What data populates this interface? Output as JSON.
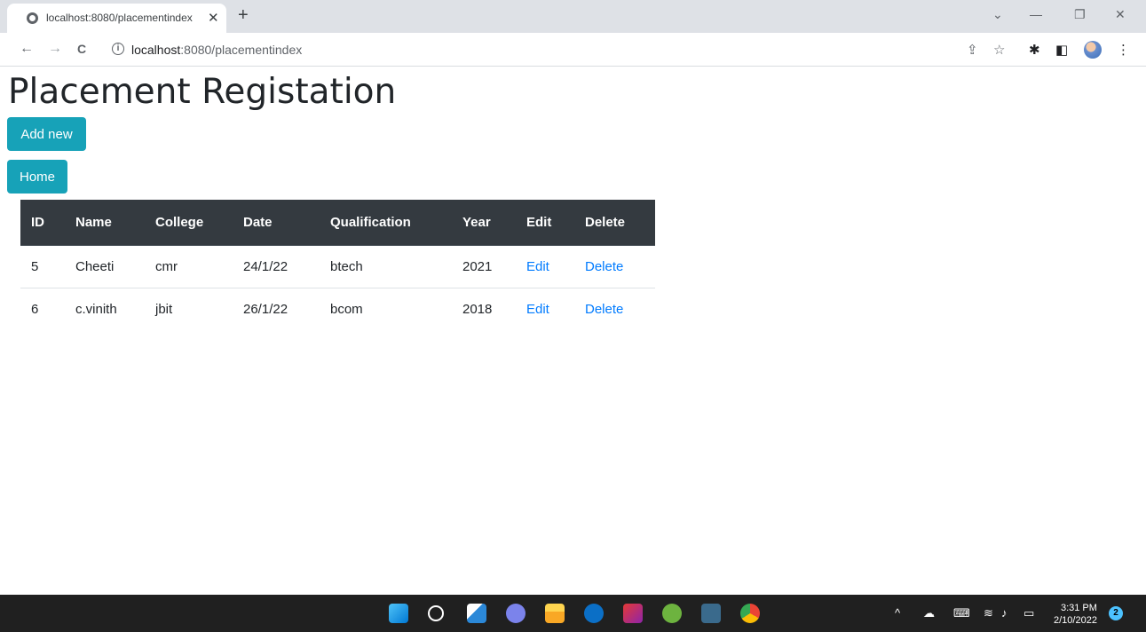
{
  "browser": {
    "tab_title": "localhost:8080/placementindex",
    "tab_close": "✕",
    "new_tab": "+",
    "url_host": "localhost",
    "url_rest": ":8080/placementindex",
    "window_controls": {
      "minimize": "—",
      "restore": "❐",
      "close": "✕",
      "tab_search": "⌄"
    },
    "toolbar_icons": {
      "back": "←",
      "forward": "→",
      "reload": "C",
      "info": "i",
      "share": "⇪",
      "bookmark": "☆",
      "extensions": "✱",
      "sidepanel": "◧",
      "menu": "⋮"
    }
  },
  "page": {
    "title": "Placement Registation",
    "add_new_label": "Add new",
    "home_label": "Home"
  },
  "table": {
    "headers": [
      "ID",
      "Name",
      "College",
      "Date",
      "Qualification",
      "Year",
      "Edit",
      "Delete"
    ],
    "rows": [
      {
        "id": "5",
        "name": "Cheeti",
        "college": "cmr",
        "date": "24/1/22",
        "qualification": "btech",
        "year": "2021",
        "edit": "Edit",
        "delete": "Delete"
      },
      {
        "id": "6",
        "name": "c.vinith",
        "college": "jbit",
        "date": "26/1/22",
        "qualification": "bcom",
        "year": "2018",
        "edit": "Edit",
        "delete": "Delete"
      }
    ]
  },
  "taskbar": {
    "time": "3:31 PM",
    "date": "2/10/2022",
    "notification_count": "2",
    "tray_chevron": "^"
  },
  "colors": {
    "accent_info": "#17a2b8",
    "table_header": "#343a40",
    "link": "#007bff"
  }
}
